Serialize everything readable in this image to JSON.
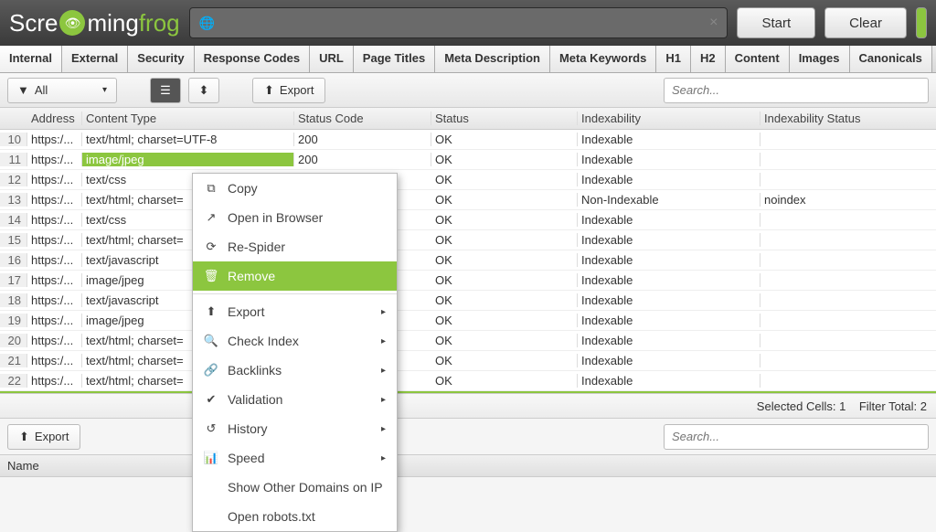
{
  "brand": {
    "part1": "Scre",
    "part2": "ming",
    "part3": "frog"
  },
  "header": {
    "start": "Start",
    "clear": "Clear"
  },
  "tabs": [
    "Internal",
    "External",
    "Security",
    "Response Codes",
    "URL",
    "Page Titles",
    "Meta Description",
    "Meta Keywords",
    "H1",
    "H2",
    "Content",
    "Images",
    "Canonicals"
  ],
  "toolbar": {
    "filter_label": "All",
    "export": "Export",
    "search_placeholder": "Search..."
  },
  "columns": {
    "address": "Address",
    "content_type": "Content Type",
    "status_code": "Status Code",
    "status": "Status",
    "indexability": "Indexability",
    "indexability_status": "Indexability Status"
  },
  "rows": [
    {
      "n": "10",
      "addr": "https:/...",
      "ct": "text/html; charset=UTF-8",
      "sc": "200",
      "st": "OK",
      "idx": "Indexable",
      "idxs": ""
    },
    {
      "n": "11",
      "addr": "https:/...",
      "ct": "image/jpeg",
      "sc": "200",
      "st": "OK",
      "idx": "Indexable",
      "idxs": ""
    },
    {
      "n": "12",
      "addr": "https:/...",
      "ct": "text/css",
      "sc": "",
      "st": "OK",
      "idx": "Indexable",
      "idxs": ""
    },
    {
      "n": "13",
      "addr": "https:/...",
      "ct": "text/html; charset=",
      "sc": "",
      "st": "OK",
      "idx": "Non-Indexable",
      "idxs": "noindex"
    },
    {
      "n": "14",
      "addr": "https:/...",
      "ct": "text/css",
      "sc": "",
      "st": "OK",
      "idx": "Indexable",
      "idxs": ""
    },
    {
      "n": "15",
      "addr": "https:/...",
      "ct": "text/html; charset=",
      "sc": "",
      "st": "OK",
      "idx": "Indexable",
      "idxs": ""
    },
    {
      "n": "16",
      "addr": "https:/...",
      "ct": "text/javascript",
      "sc": "",
      "st": "OK",
      "idx": "Indexable",
      "idxs": ""
    },
    {
      "n": "17",
      "addr": "https:/...",
      "ct": "image/jpeg",
      "sc": "",
      "st": "OK",
      "idx": "Indexable",
      "idxs": ""
    },
    {
      "n": "18",
      "addr": "https:/...",
      "ct": "text/javascript",
      "sc": "",
      "st": "OK",
      "idx": "Indexable",
      "idxs": ""
    },
    {
      "n": "19",
      "addr": "https:/...",
      "ct": "image/jpeg",
      "sc": "",
      "st": "OK",
      "idx": "Indexable",
      "idxs": ""
    },
    {
      "n": "20",
      "addr": "https:/...",
      "ct": "text/html; charset=",
      "sc": "",
      "st": "OK",
      "idx": "Indexable",
      "idxs": ""
    },
    {
      "n": "21",
      "addr": "https:/...",
      "ct": "text/html; charset=",
      "sc": "",
      "st": "OK",
      "idx": "Indexable",
      "idxs": ""
    },
    {
      "n": "22",
      "addr": "https:/...",
      "ct": "text/html; charset=",
      "sc": "",
      "st": "OK",
      "idx": "Indexable",
      "idxs": ""
    }
  ],
  "selected_row": 1,
  "status": {
    "selected_cells": "Selected Cells:  1",
    "filter_total": "Filter Total:  2"
  },
  "bottom": {
    "export": "Export",
    "search_placeholder": "Search...",
    "name_col": "Name"
  },
  "contextmenu": {
    "copy": "Copy",
    "open_browser": "Open in Browser",
    "respider": "Re-Spider",
    "remove": "Remove",
    "export": "Export",
    "check_index": "Check Index",
    "backlinks": "Backlinks",
    "validation": "Validation",
    "history": "History",
    "speed": "Speed",
    "other_domains": "Show Other Domains on IP",
    "robots": "Open robots.txt"
  }
}
